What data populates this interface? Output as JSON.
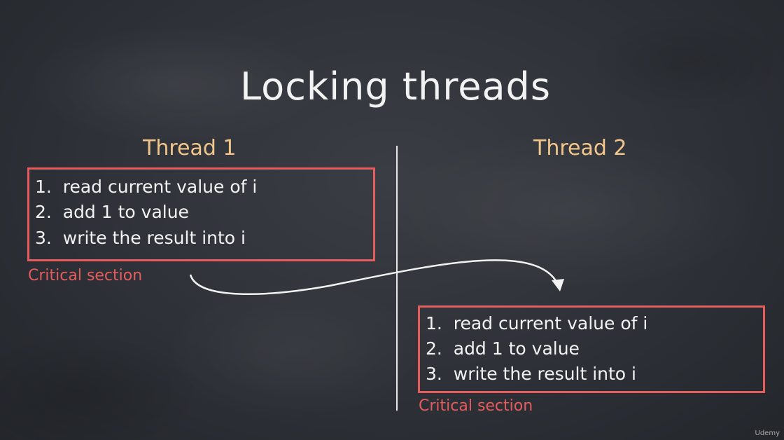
{
  "title": "Locking threads",
  "thread1": {
    "label": "Thread 1",
    "steps": [
      "1.  read current value of i",
      "2.  add 1 to value",
      "3.  write the result into i"
    ],
    "caption": "Critical section"
  },
  "thread2": {
    "label": "Thread 2",
    "steps": [
      "1.  read current value of i",
      "2.  add 1 to value",
      "3.  write the result into i"
    ],
    "caption": "Critical section"
  },
  "watermark": "Udemy",
  "colors": {
    "background": "#2c3036",
    "box": "#e65b5b",
    "thread_label": "#f2c689",
    "text": "#f2f2f2"
  }
}
